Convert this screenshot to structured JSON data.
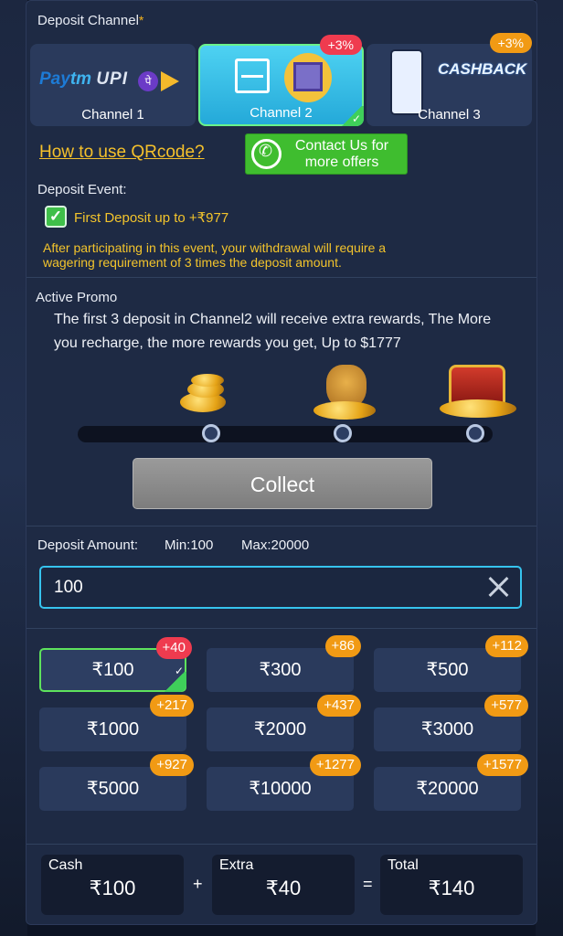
{
  "deposit_channel": {
    "title": "Deposit Channel",
    "required_star": "*",
    "channels": [
      {
        "label": "Channel 1",
        "logo_text": "Paytm UPI"
      },
      {
        "label": "Channel 2",
        "badge": "+3%"
      },
      {
        "label": "Channel 3",
        "badge": "+3%",
        "logo_text": "CASHBACK"
      }
    ]
  },
  "links": {
    "how_to_qr": "How to use QRcode?",
    "contact_line1": "Contact Us for",
    "contact_line2": "more offers"
  },
  "deposit_event": {
    "title": "Deposit Event:",
    "option": "First Deposit up to +₹977",
    "note_line1": "After participating in this event, your withdrawal will require a",
    "note_line2": "wagering requirement of 3 times the deposit amount."
  },
  "active_promo": {
    "title": "Active Promo",
    "line1": "The first 3 deposit in Channel2 will receive extra rewards, The More",
    "line2": "you recharge, the more rewards you get, Up to $1777",
    "collect_label": "Collect",
    "progress_steps": 3
  },
  "deposit_amount": {
    "label": "Deposit Amount:",
    "min": "Min:100",
    "max": "Max:20000",
    "input_value": "100"
  },
  "amount_options": [
    {
      "amount": "₹100",
      "bonus": "+40",
      "selected": true
    },
    {
      "amount": "₹300",
      "bonus": "+86"
    },
    {
      "amount": "₹500",
      "bonus": "+112"
    },
    {
      "amount": "₹1000",
      "bonus": "+217"
    },
    {
      "amount": "₹2000",
      "bonus": "+437"
    },
    {
      "amount": "₹3000",
      "bonus": "+577"
    },
    {
      "amount": "₹5000",
      "bonus": "+927"
    },
    {
      "amount": "₹10000",
      "bonus": "+1277"
    },
    {
      "amount": "₹20000",
      "bonus": "+1577"
    }
  ],
  "summary": {
    "cash_label": "Cash",
    "cash_value": "₹100",
    "plus": "+",
    "extra_label": "Extra",
    "extra_value": "₹40",
    "equals": "=",
    "total_label": "Total",
    "total_value": "₹140"
  },
  "colors": {
    "accent_gold": "#f5c12b",
    "selected_green": "#5ee35c",
    "badge_red": "#ef3b4f",
    "badge_orange": "#f19a14",
    "input_border": "#36c3ee"
  }
}
